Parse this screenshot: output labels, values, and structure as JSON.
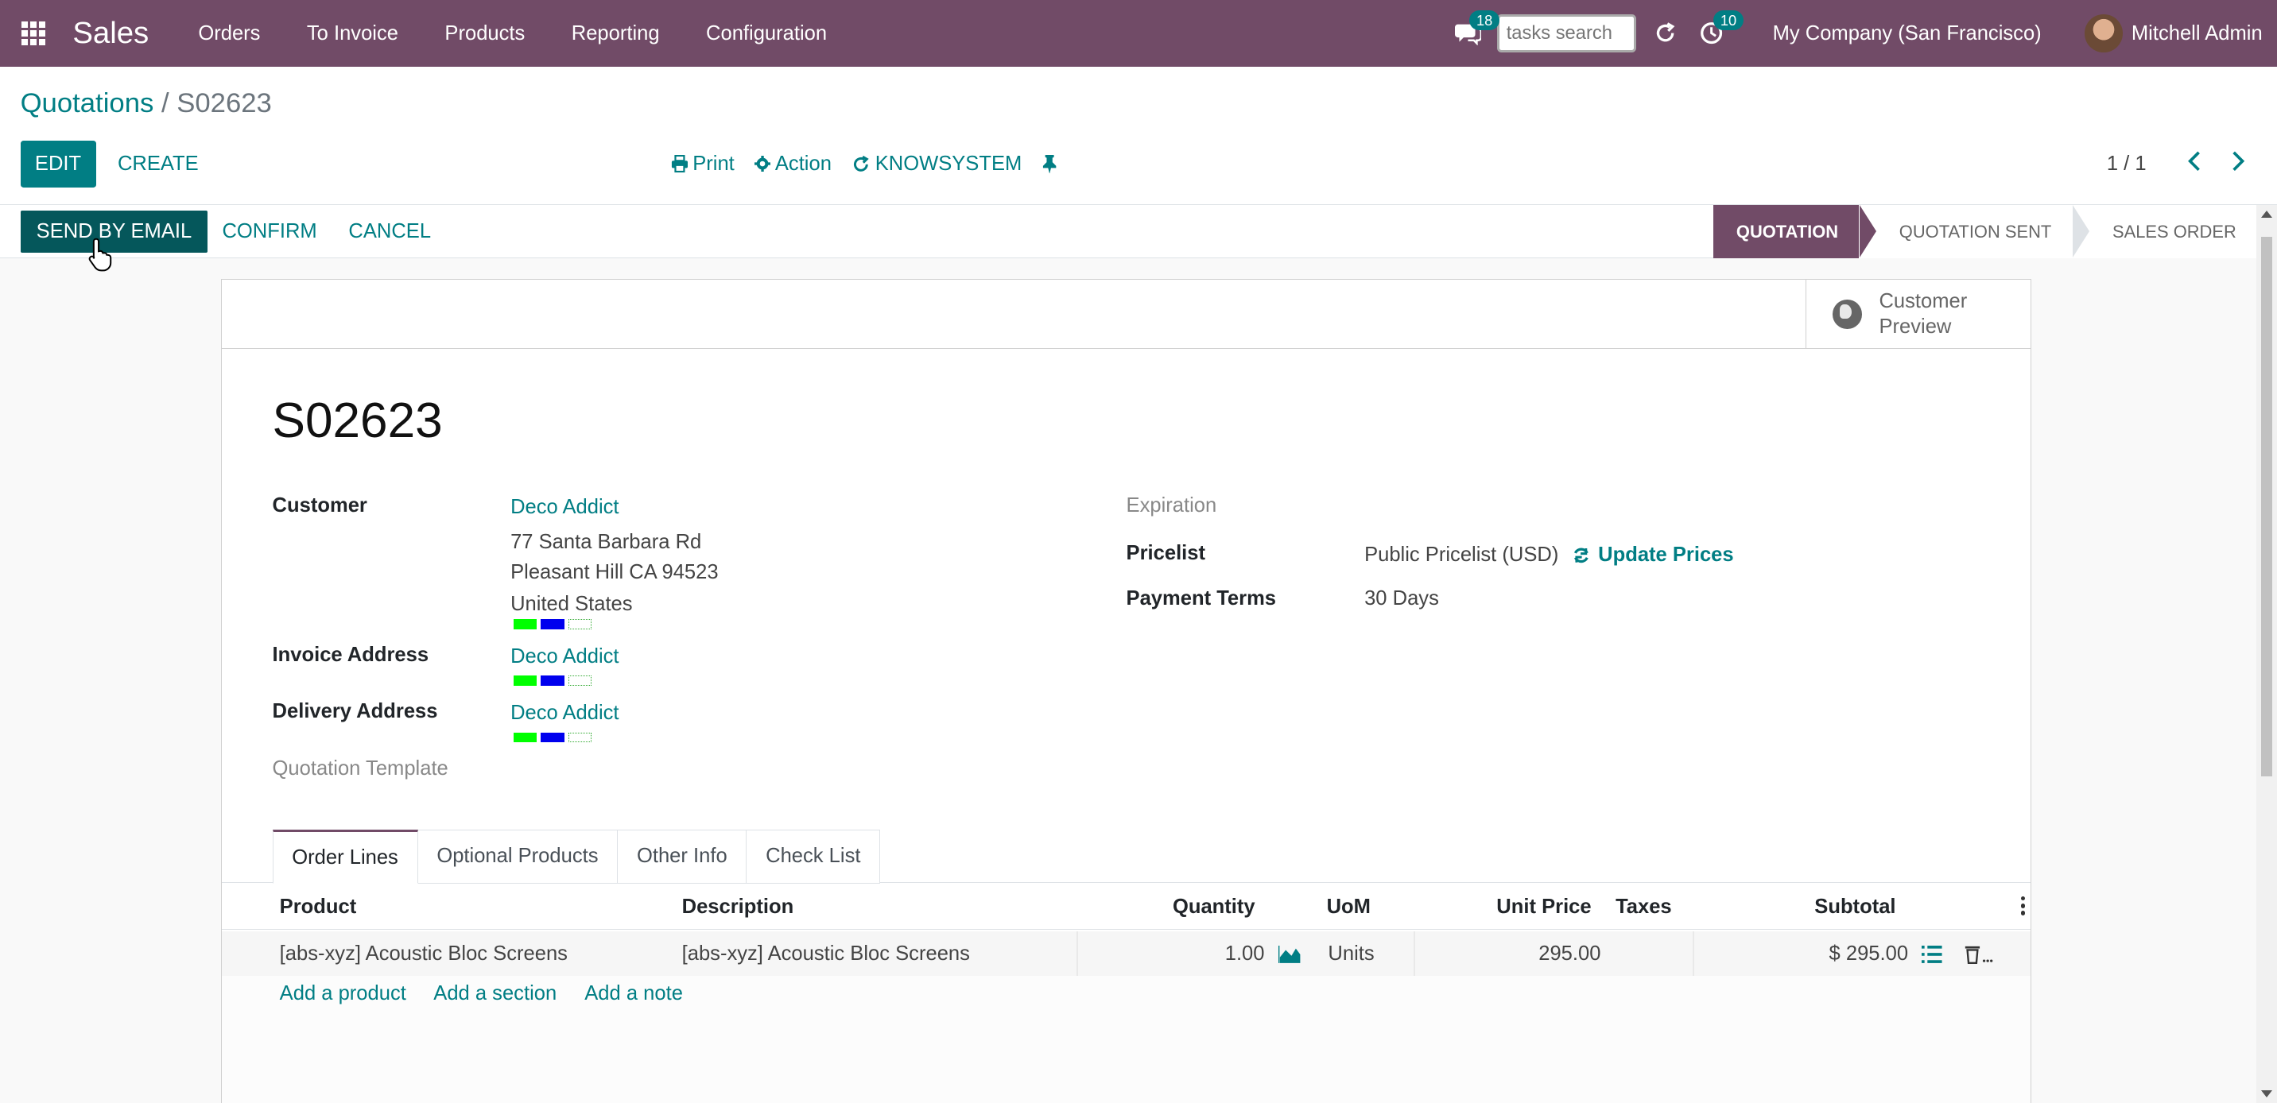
{
  "navbar": {
    "app_name": "Sales",
    "menus": [
      "Orders",
      "To Invoice",
      "Products",
      "Reporting",
      "Configuration"
    ],
    "messages_count": "18",
    "tasks_search_placeholder": "tasks search",
    "activities_count": "10",
    "company": "My Company (San Francisco)",
    "user": "Mitchell Admin"
  },
  "breadcrumb": {
    "parent": "Quotations",
    "separator": "/",
    "current": "S02623"
  },
  "control_panel": {
    "edit_label": "EDIT",
    "create_label": "CREATE",
    "print_label": "Print",
    "action_label": "Action",
    "knowsystem_label": "KNOWSYSTEM",
    "pager": "1 / 1"
  },
  "statusbar": {
    "send_email_label": "SEND BY EMAIL",
    "confirm_label": "CONFIRM",
    "cancel_label": "CANCEL",
    "stages": [
      "QUOTATION",
      "QUOTATION SENT",
      "SALES ORDER"
    ],
    "active_stage": "QUOTATION"
  },
  "form": {
    "preview_line1": "Customer",
    "preview_line2": "Preview",
    "title": "S02623",
    "customer_label": "Customer",
    "customer_name": "Deco Addict",
    "address_line1": "77 Santa Barbara Rd",
    "address_line2": "Pleasant Hill CA 94523",
    "address_line3": "United States",
    "invoice_address_label": "Invoice Address",
    "invoice_address": "Deco Addict",
    "delivery_address_label": "Delivery Address",
    "delivery_address": "Deco Addict",
    "quotation_template_label": "Quotation Template",
    "expiration_label": "Expiration",
    "pricelist_label": "Pricelist",
    "pricelist_value": "Public Pricelist (USD)",
    "update_prices_label": "Update Prices",
    "payment_terms_label": "Payment Terms",
    "payment_terms_value": "30 Days"
  },
  "tabs": [
    "Order Lines",
    "Optional Products",
    "Other Info",
    "Check List"
  ],
  "table": {
    "columns": [
      "Product",
      "Description",
      "Quantity",
      "UoM",
      "Unit Price",
      "Taxes",
      "Subtotal"
    ],
    "rows": [
      {
        "product": "[abs-xyz] Acoustic Bloc Screens",
        "description": "[abs-xyz] Acoustic Bloc Screens",
        "quantity": "1.00",
        "uom": "Units",
        "unit_price": "295.00",
        "taxes": "",
        "subtotal": "$ 295.00"
      }
    ],
    "add_product": "Add a product",
    "add_section": "Add a section",
    "add_note": "Add a note"
  },
  "colors": {
    "brand": "#714b67",
    "accent": "#017e84",
    "primary_dark": "#05575b"
  }
}
